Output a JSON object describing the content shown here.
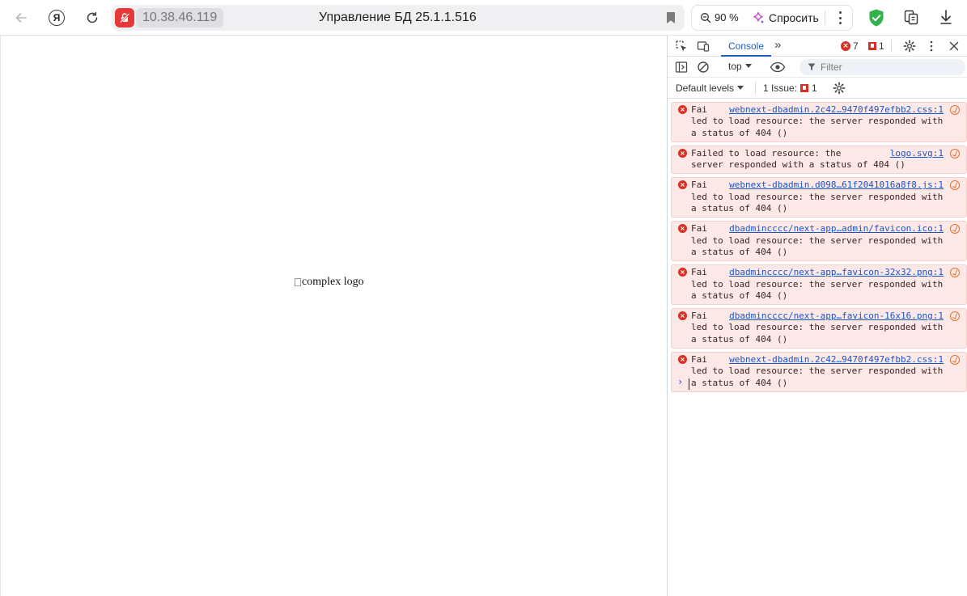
{
  "browser": {
    "address": "10.38.46.119",
    "tab_title": "Управление БД 25.1.1.516",
    "zoom": "90 %",
    "ask_label": "Спросить",
    "colors": {
      "security_badge": "#e5393a",
      "shield": "#2fb34a"
    }
  },
  "viewport": {
    "broken_image_alt": "complex logo"
  },
  "devtools": {
    "active_tab": "Console",
    "error_count": "7",
    "issue_count": "1",
    "context": "top",
    "filter_placeholder": "Filter",
    "levels_label": "Default levels",
    "issues_label": "1 Issue:",
    "issues_badge": "1",
    "messages": [
      {
        "prefix": "Fai",
        "source": "webnext-dbadmin.2c42…9470f497efbb2.css:1",
        "text": "led to load resource: the server responded with a status of 404 ()"
      },
      {
        "prefix": "Failed to load resource: the",
        "source": "logo.svg:1",
        "text": "server responded with a status of 404 ()"
      },
      {
        "prefix": "Fai",
        "source": "webnext-dbadmin.d098…61f2041016a8f8.js:1",
        "text": "led to load resource: the server responded with a status of 404 ()"
      },
      {
        "prefix": "Fai",
        "source": "dbadmincccc/next-app…admin/favicon.ico:1",
        "text": "led to load resource: the server responded with a status of 404 ()"
      },
      {
        "prefix": "Fai",
        "source": "dbadmincccc/next-app…favicon-32x32.png:1",
        "text": "led to load resource: the server responded with a status of 404 ()"
      },
      {
        "prefix": "Fai",
        "source": "dbadmincccc/next-app…favicon-16x16.png:1",
        "text": "led to load resource: the server responded with a status of 404 ()"
      },
      {
        "prefix": "Fai",
        "source": "webnext-dbadmin.2c42…9470f497efbb2.css:1",
        "text": "led to load resource: the server responded with a status of 404 ()"
      }
    ],
    "prompt_symbol": "›"
  }
}
